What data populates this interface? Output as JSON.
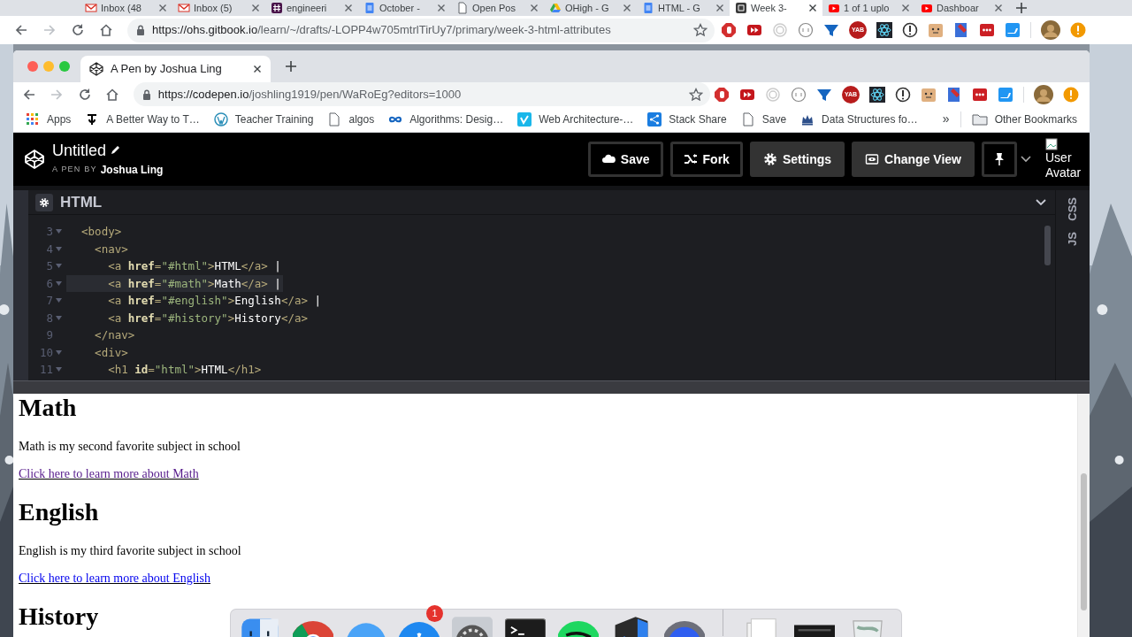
{
  "outer_browser": {
    "tabs": [
      {
        "title": "Inbox (48",
        "selected": false
      },
      {
        "title": "Inbox (5)",
        "selected": false
      },
      {
        "title": "engineeri",
        "selected": false
      },
      {
        "title": "October -",
        "selected": false
      },
      {
        "title": "Open Pos",
        "selected": false
      },
      {
        "title": "OHigh - G",
        "selected": false
      },
      {
        "title": "HTML - G",
        "selected": false
      },
      {
        "title": "Week 3-",
        "selected": true
      },
      {
        "title": "1 of 1 uplo",
        "selected": false
      },
      {
        "title": "Dashboar",
        "selected": false
      }
    ],
    "url_host": "https://ohs.gitbook.io",
    "url_path": "/learn/~/drafts/-LOPP4w705mtrlTirUy7/primary/week-3-html-attributes",
    "extension_label": "YAB"
  },
  "window": {
    "tab": {
      "title": "A Pen by Joshua Ling",
      "selected": true
    },
    "url_host": "https://codepen.io",
    "url_path": "/joshling1919/pen/WaRoEg?editors=1000",
    "extension_label": "YAB",
    "bookmarks": [
      {
        "label": "Apps"
      },
      {
        "label": "A Better Way to T…"
      },
      {
        "label": "Teacher Training"
      },
      {
        "label": "algos"
      },
      {
        "label": "Algorithms: Desig…"
      },
      {
        "label": "Web Architecture-…"
      },
      {
        "label": "Stack Share"
      },
      {
        "label": "Save"
      },
      {
        "label": "Data Structures fo…"
      }
    ],
    "bookmarks_overflow": "»",
    "other_bookmarks": "Other Bookmarks"
  },
  "codepen": {
    "title": "Untitled",
    "byline_prefix": "A PEN BY",
    "author": "Joshua Ling",
    "buttons": [
      {
        "label": "Save",
        "kind": "outline"
      },
      {
        "label": "Fork",
        "kind": "outline"
      },
      {
        "label": "Settings",
        "kind": "filled"
      },
      {
        "label": "Change View",
        "kind": "filled"
      }
    ],
    "avatar_alt": "User Avatar"
  },
  "editor": {
    "title": "HTML",
    "side_tabs": [
      "CSS",
      "JS"
    ],
    "lines": [
      {
        "number": "3",
        "foldable": true,
        "active": false,
        "tokens": [
          {
            "kind": "tag",
            "text": "  <body>"
          }
        ]
      },
      {
        "number": "4",
        "foldable": true,
        "active": false,
        "tokens": [
          {
            "kind": "tag",
            "text": "    <nav>"
          }
        ]
      },
      {
        "number": "5",
        "foldable": true,
        "active": false,
        "tokens": [
          {
            "kind": "tag",
            "text": "      <a"
          },
          {
            "kind": "attr",
            "text": " href"
          },
          {
            "kind": "punct",
            "text": "="
          },
          {
            "kind": "string",
            "text": "\"#html\""
          },
          {
            "kind": "tag",
            "text": ">"
          },
          {
            "kind": "text",
            "text": "HTML"
          },
          {
            "kind": "tag",
            "text": "</a>"
          },
          {
            "kind": "text",
            "text": " |"
          }
        ]
      },
      {
        "number": "6",
        "foldable": true,
        "active": true,
        "tokens": [
          {
            "kind": "tag",
            "text": "      <a"
          },
          {
            "kind": "attr",
            "text": " href"
          },
          {
            "kind": "punct",
            "text": "="
          },
          {
            "kind": "string",
            "text": "\"#math\""
          },
          {
            "kind": "tag",
            "text": ">"
          },
          {
            "kind": "text",
            "text": "Math"
          },
          {
            "kind": "tag",
            "text": "</a>"
          },
          {
            "kind": "text",
            "text": " |"
          }
        ]
      },
      {
        "number": "7",
        "foldable": true,
        "active": false,
        "tokens": [
          {
            "kind": "tag",
            "text": "      <a"
          },
          {
            "kind": "attr",
            "text": " href"
          },
          {
            "kind": "punct",
            "text": "="
          },
          {
            "kind": "string",
            "text": "\"#english\""
          },
          {
            "kind": "tag",
            "text": ">"
          },
          {
            "kind": "text",
            "text": "English"
          },
          {
            "kind": "tag",
            "text": "</a>"
          },
          {
            "kind": "text",
            "text": " |"
          }
        ]
      },
      {
        "number": "8",
        "foldable": true,
        "active": false,
        "tokens": [
          {
            "kind": "tag",
            "text": "      <a"
          },
          {
            "kind": "attr",
            "text": " href"
          },
          {
            "kind": "punct",
            "text": "="
          },
          {
            "kind": "string",
            "text": "\"#history\""
          },
          {
            "kind": "tag",
            "text": ">"
          },
          {
            "kind": "text",
            "text": "History"
          },
          {
            "kind": "tag",
            "text": "</a>"
          }
        ]
      },
      {
        "number": "9",
        "foldable": false,
        "active": false,
        "tokens": [
          {
            "kind": "tag",
            "text": "    </nav>"
          }
        ]
      },
      {
        "number": "10",
        "foldable": true,
        "active": false,
        "tokens": [
          {
            "kind": "tag",
            "text": "    <div>"
          }
        ]
      },
      {
        "number": "11",
        "foldable": true,
        "active": false,
        "tokens": [
          {
            "kind": "tag",
            "text": "      <h1"
          },
          {
            "kind": "attr",
            "text": " id"
          },
          {
            "kind": "punct",
            "text": "="
          },
          {
            "kind": "string",
            "text": "\"html\""
          },
          {
            "kind": "tag",
            "text": ">"
          },
          {
            "kind": "text",
            "text": "HTML"
          },
          {
            "kind": "tag",
            "text": "</h1>"
          }
        ]
      }
    ]
  },
  "preview": {
    "blocks": [
      {
        "kind": "heading",
        "text": "Math"
      },
      {
        "kind": "paragraph",
        "text": "Math is my second favorite subject in school"
      },
      {
        "kind": "link",
        "text": "Click here to learn more about Math",
        "visited": true
      },
      {
        "kind": "heading",
        "text": "English"
      },
      {
        "kind": "paragraph",
        "text": "English is my third favorite subject in school"
      },
      {
        "kind": "link",
        "text": "Click here to learn more about English",
        "visited": false
      },
      {
        "kind": "heading",
        "text": "History"
      }
    ]
  },
  "dock": {
    "items": [
      {
        "kind": "finder"
      },
      {
        "kind": "chrome"
      },
      {
        "kind": "messages"
      },
      {
        "kind": "appstore",
        "badge": "1"
      },
      {
        "kind": "settings"
      },
      {
        "kind": "terminal"
      },
      {
        "kind": "spotify"
      },
      {
        "kind": "vscode"
      },
      {
        "kind": "orb"
      },
      {
        "kind": "separator"
      },
      {
        "kind": "documents"
      },
      {
        "kind": "screen"
      },
      {
        "kind": "trash"
      }
    ]
  }
}
